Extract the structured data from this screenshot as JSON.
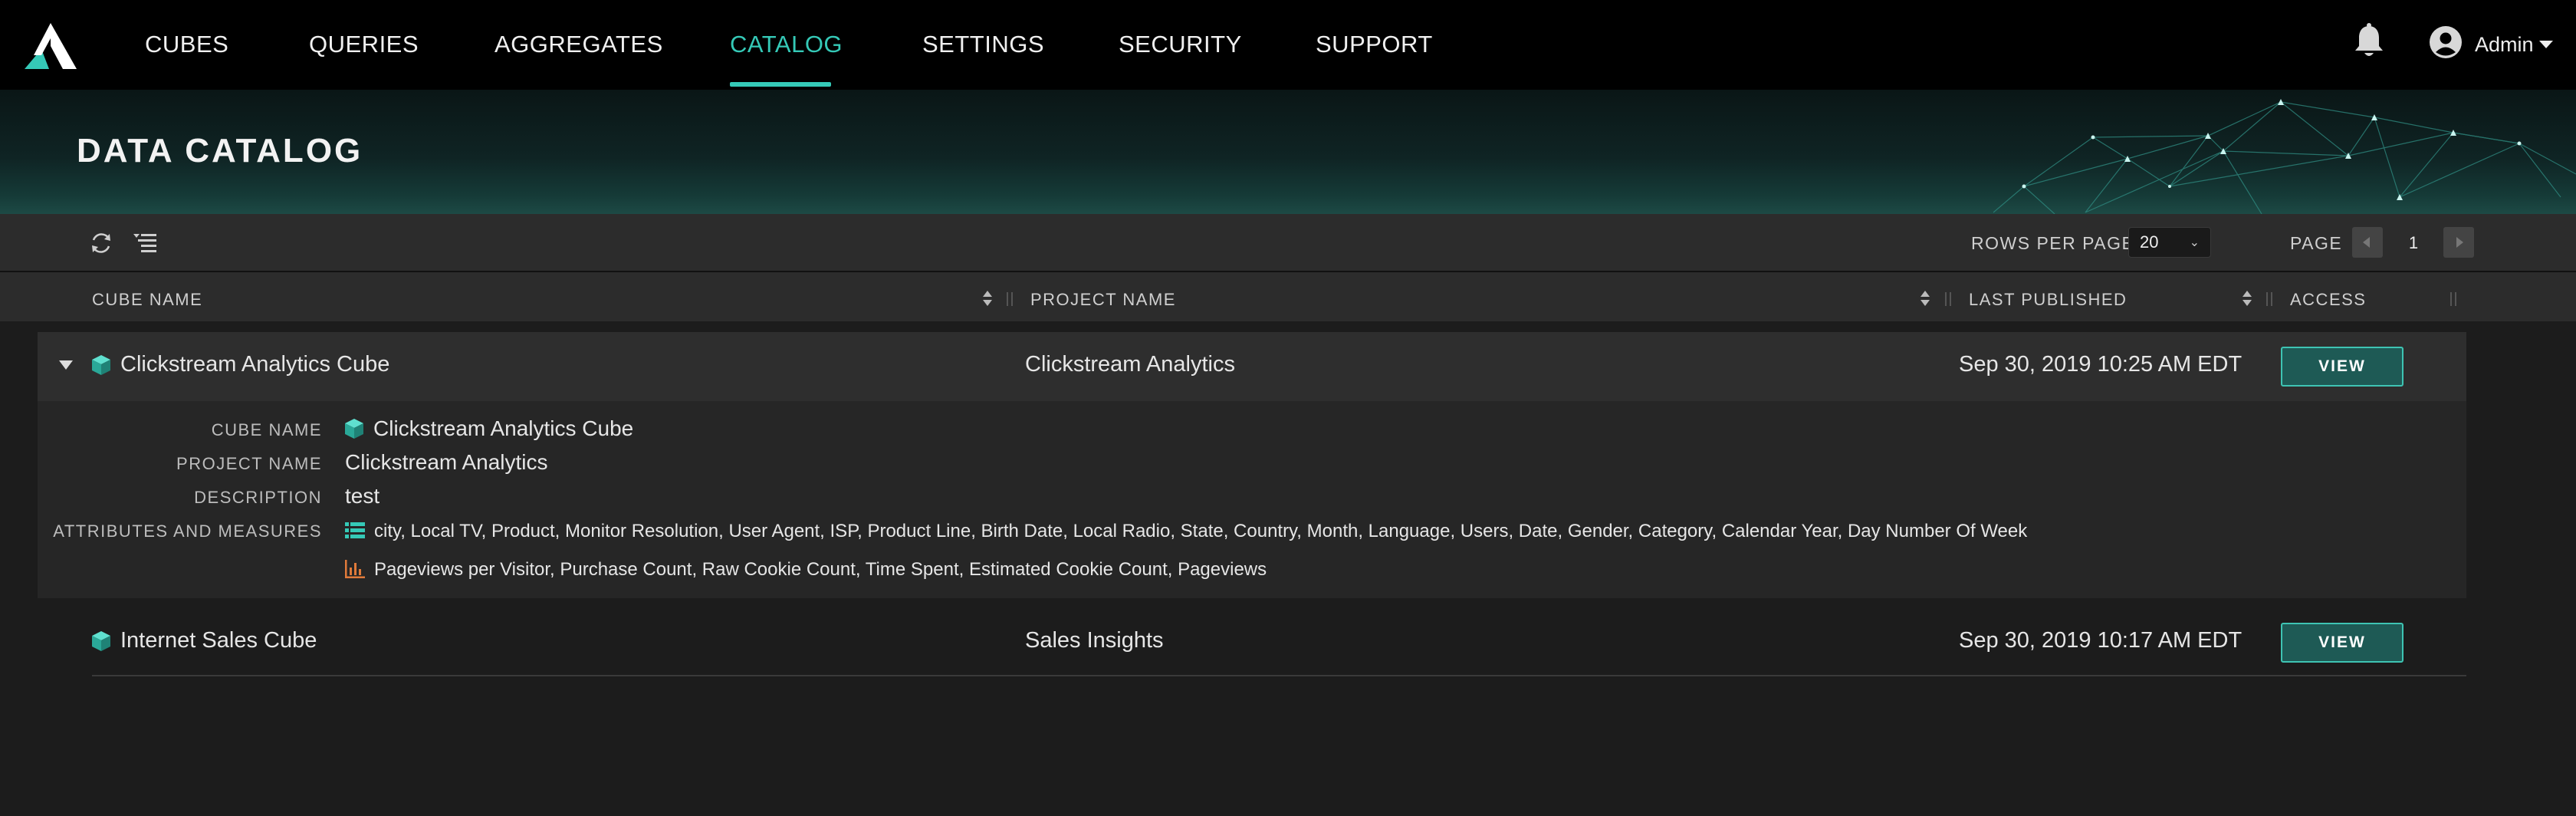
{
  "nav": {
    "items": [
      {
        "label": "CUBES"
      },
      {
        "label": "QUERIES"
      },
      {
        "label": "AGGREGATES"
      },
      {
        "label": "CATALOG",
        "active": true
      },
      {
        "label": "SETTINGS"
      },
      {
        "label": "SECURITY"
      },
      {
        "label": "SUPPORT"
      }
    ],
    "user": "Admin",
    "icons": [
      "logo-icon",
      "bell-icon",
      "user-avatar-icon",
      "chevron-down-icon"
    ]
  },
  "page": {
    "title": "DATA CATALOG"
  },
  "toolbar": {
    "icons": [
      "refresh-icon",
      "collapse-list-icon"
    ],
    "rows_per_page_label": "ROWS PER PAGE",
    "rows_per_page_value": "20",
    "page_label": "PAGE",
    "page_value": "1"
  },
  "table": {
    "columns": [
      "CUBE NAME",
      "PROJECT NAME",
      "LAST PUBLISHED",
      "ACCESS"
    ],
    "rows": [
      {
        "cube_name": "Clickstream Analytics Cube",
        "project_name": "Clickstream Analytics",
        "last_published": "Sep 30, 2019 10:25 AM EDT",
        "access": "VIEW",
        "expanded": true,
        "details": {
          "cube_name_label": "CUBE NAME",
          "cube_name": "Clickstream Analytics Cube",
          "project_name_label": "PROJECT NAME",
          "project_name": "Clickstream Analytics",
          "description_label": "DESCRIPTION",
          "description": "test",
          "attributes_label": "ATTRIBUTES AND MEASURES",
          "attributes": "city, Local TV, Product, Monitor Resolution, User Agent, ISP, Product Line, Birth Date, Local Radio, State, Country, Month, Language, Users, Date, Gender, Category, Calendar Year, Day Number Of Week",
          "measures": "Pageviews per Visitor, Purchase Count, Raw Cookie Count, Time Spent, Estimated Cookie Count, Pageviews"
        }
      },
      {
        "cube_name": "Internet Sales Cube",
        "project_name": "Sales Insights",
        "last_published": "Sep 30, 2019 10:17 AM EDT",
        "access": "VIEW",
        "expanded": false
      }
    ]
  },
  "colors": {
    "accent": "#35c9b7",
    "nav_bg": "#000000",
    "page_bg": "#1c1c1c",
    "measure_icon": "#e07a3a"
  }
}
